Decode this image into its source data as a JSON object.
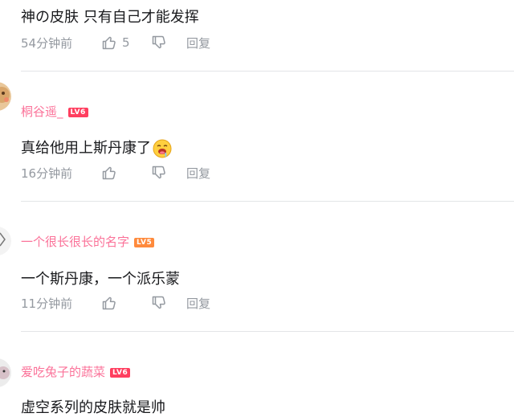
{
  "comments": [
    {
      "username": "",
      "level": "",
      "text": "神の皮肤 只有自己才能发挥",
      "time": "54分钟前",
      "likes": "5",
      "reply": "回复"
    },
    {
      "username": "桐谷遥_",
      "level": "LV6",
      "level_color": "#ff3e5f",
      "text": "真给他用上斯丹康了",
      "emoji": "drooling-face-emoji",
      "time": "16分钟前",
      "likes": "",
      "reply": "回复"
    },
    {
      "username": "一个很长很长的名字",
      "level": "LV5",
      "level_color": "#ff8a3c",
      "text": "一个斯丹康，一个派乐蒙",
      "time": "11分钟前",
      "likes": "",
      "reply": "回复"
    },
    {
      "username": "爱吃兔子的蔬菜",
      "level": "LV6",
      "level_color": "#ff3e5f",
      "text": "虚空系列的皮肤就是帅",
      "time": "",
      "likes": "",
      "reply": ""
    }
  ],
  "colors": {
    "username": "#fb7299",
    "meta": "#9499a0",
    "text": "#18191c",
    "divider": "#e3e5e7"
  },
  "icons": [
    "thumbs-up-icon",
    "thumbs-down-icon"
  ]
}
